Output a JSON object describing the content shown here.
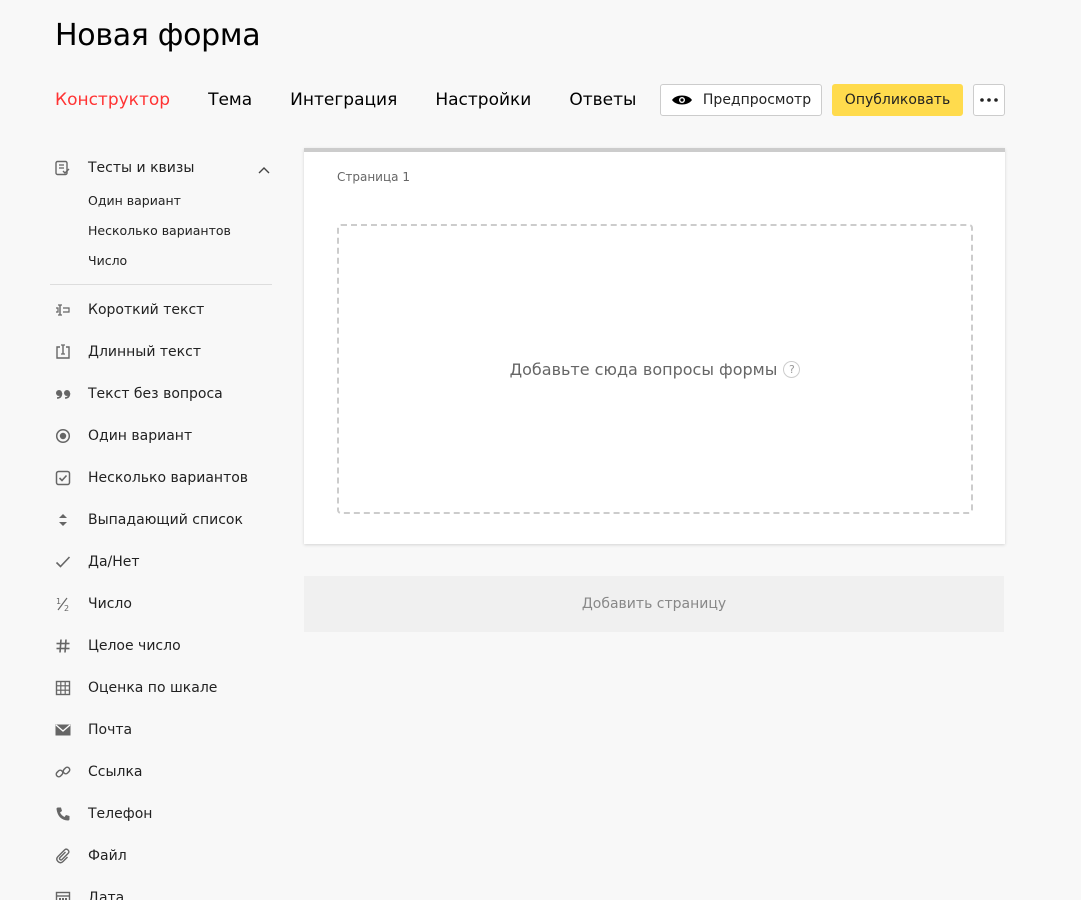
{
  "title": "Новая форма",
  "tabs": [
    {
      "label": "Конструктор",
      "active": true
    },
    {
      "label": "Тема"
    },
    {
      "label": "Интеграция"
    },
    {
      "label": "Настройки"
    },
    {
      "label": "Ответы"
    }
  ],
  "toolbar": {
    "preview_label": "Предпросмотр",
    "publish_label": "Опубликовать",
    "more_icon": "more-dots-icon"
  },
  "sidebar": {
    "group": {
      "label": "Тесты и квизы",
      "icon": "quiz-icon",
      "expanded": true,
      "items": [
        "Один вариант",
        "Несколько вариантов",
        "Число"
      ]
    },
    "items": [
      {
        "label": "Короткий текст",
        "icon": "short-text-icon"
      },
      {
        "label": "Длинный текст",
        "icon": "long-text-icon"
      },
      {
        "label": "Текст без вопроса",
        "icon": "quote-icon"
      },
      {
        "label": "Один вариант",
        "icon": "radio-icon"
      },
      {
        "label": "Несколько вариантов",
        "icon": "checkbox-icon"
      },
      {
        "label": "Выпадающий список",
        "icon": "dropdown-icon"
      },
      {
        "label": "Да/Нет",
        "icon": "check-icon"
      },
      {
        "label": "Число",
        "icon": "fraction-icon"
      },
      {
        "label": "Целое число",
        "icon": "hash-icon"
      },
      {
        "label": "Оценка по шкале",
        "icon": "grid-icon"
      },
      {
        "label": "Почта",
        "icon": "mail-icon"
      },
      {
        "label": "Ссылка",
        "icon": "link-icon"
      },
      {
        "label": "Телефон",
        "icon": "phone-icon"
      },
      {
        "label": "Файл",
        "icon": "paperclip-icon"
      },
      {
        "label": "Дата",
        "icon": "calendar-icon"
      }
    ]
  },
  "card": {
    "page_label": "Страница 1",
    "dropzone_text": "Добавьте сюда вопросы формы",
    "help": "?"
  },
  "add_page_label": "Добавить страницу",
  "colors": {
    "accent": "#ff3333",
    "publish": "#ffdb4d"
  }
}
